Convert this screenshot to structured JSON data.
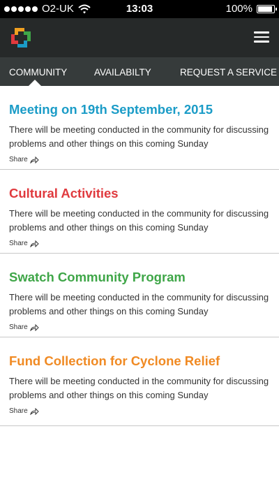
{
  "status_bar": {
    "carrier": "O2-UK",
    "time": "13:03",
    "battery_text": "100%",
    "battery_level": 1.0,
    "signal_bars": 5
  },
  "header": {
    "logo_icon": "pinwheel-logo-icon",
    "menu_icon": "hamburger-menu-icon"
  },
  "tabs": [
    {
      "label": "COMMUNITY",
      "active": true
    },
    {
      "label": "AVAILABILTY",
      "active": false
    },
    {
      "label": "REQUEST A SERVICE",
      "active": false
    }
  ],
  "posts": [
    {
      "title": "Meeting on 19th September, 2015",
      "color": "#1b9cc7",
      "body": "There will be meeting conducted in the community for discussing problems and other things on this coming Sunday",
      "share_label": "Share"
    },
    {
      "title": "Cultural Activities",
      "color": "#e03a3e",
      "body": "There will be meeting conducted in the community for discussing problems and other things on this coming Sunday",
      "share_label": "Share"
    },
    {
      "title": "Swatch Community Program",
      "color": "#3fa648",
      "body": "There will be meeting conducted in the community for discussing problems and other things on this coming Sunday",
      "share_label": "Share"
    },
    {
      "title": "Fund Collection for Cyclone Relief",
      "color": "#f08a23",
      "body": "There will be meeting conducted in the community for discussing problems and other things on this coming Sunday",
      "share_label": "Share"
    }
  ],
  "colors": {
    "header_bg": "#262929",
    "tab_bg": "#363b3b"
  }
}
